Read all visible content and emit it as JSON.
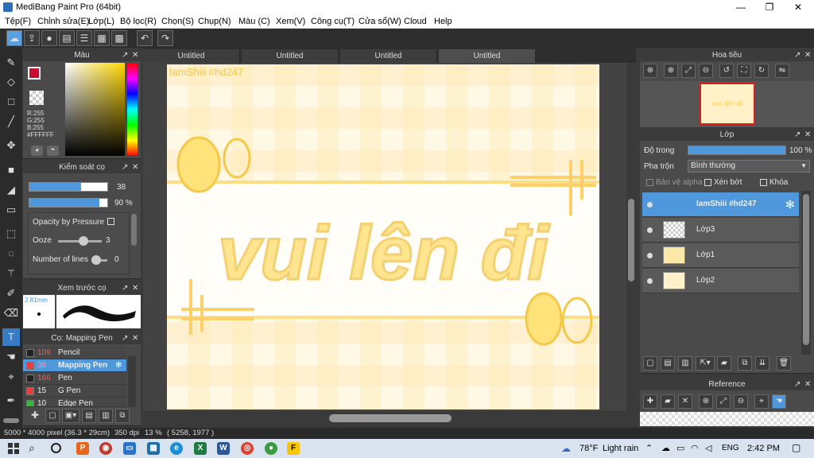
{
  "window": {
    "title": "MediBang Paint Pro (64bit)",
    "minimize": "—",
    "maximize": "❐",
    "close": "✕"
  },
  "menu": [
    "Tệp(F)",
    "Chỉnh sửa(E)",
    "Lớp(L)",
    "Bộ lọc(R)",
    "Chọn(S)",
    "Chụp(N)",
    "Màu (C)",
    "Xem(V)",
    "Công cụ(T)",
    "Cửa sổ(W)",
    "Cloud",
    "Help"
  ],
  "tabs": [
    "Untitled",
    "Untitled",
    "Untitled",
    "Untitled"
  ],
  "color_panel": {
    "title": "Màu",
    "r": "R:255",
    "g": "G:255",
    "b": "B:255",
    "hex": "#FFFFFF"
  },
  "brush_control": {
    "title": "Kiểm soát cọ",
    "size_value": "38",
    "size_fraction": 0.66,
    "opacity_value": "90 %",
    "opacity_fraction": 0.9,
    "opacity_by_pressure": "Opacity by Pressure",
    "ooze_label": "Ooze",
    "ooze_value": "3",
    "lines_label": "Number of lines",
    "lines_value": "0"
  },
  "brush_preview": {
    "title": "Xem trước cọ",
    "size": "2.81mm"
  },
  "brush_list": {
    "title": "Cọ: Mapping Pen",
    "items": [
      {
        "num": "109",
        "name": "Pencil"
      },
      {
        "num": "38",
        "name": "Mapping Pen"
      },
      {
        "num": "166",
        "name": "Pen"
      },
      {
        "num": "15",
        "name": "G Pen"
      },
      {
        "num": "10",
        "name": "Edge Pen"
      }
    ]
  },
  "canvas": {
    "watermark": "IamShiii #hd247",
    "artwork_text": "vui lên đi"
  },
  "navigator": {
    "title": "Hoa tiêu",
    "thumb_text": "vui lên đi"
  },
  "layer_panel": {
    "title": "Lớp",
    "opacity_label": "Độ trong",
    "opacity_value": "100 %",
    "blend_label": "Pha trộn",
    "blend_value": "Bình thường",
    "protect_alpha": "Bảo vệ alpha",
    "clip": "Xén bớt",
    "lock": "Khóa",
    "layers": [
      {
        "name": "IamShiii #hd247"
      },
      {
        "name": "Lớp3"
      },
      {
        "name": "Lớp1"
      },
      {
        "name": "Lớp2"
      }
    ]
  },
  "reference": {
    "title": "Reference"
  },
  "status": {
    "size": "5000 * 4000 pixel",
    "cm": "(36.3 * 29cm)",
    "dpi": "350 dpi",
    "zoom": "13 %",
    "coords": "( 5258, 1977 )"
  },
  "taskbar": {
    "weather_temp": "78°F",
    "weather_desc": "Light rain",
    "lang": "ENG",
    "time": "2:42 PM"
  },
  "colors": {
    "accent": "#4f98dc",
    "canvas_bg": "#fff1c8",
    "art": "#ffe38a"
  }
}
